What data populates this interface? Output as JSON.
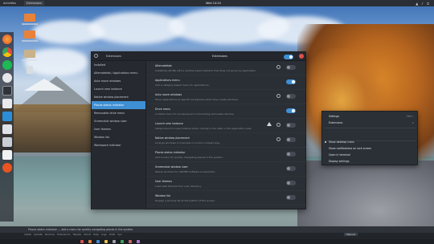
{
  "top_panel": {
    "activities": "Activities",
    "app_name": "Extensions",
    "clock": "Wed 14:24"
  },
  "settings_window": {
    "title": "Extensions",
    "master_toggle_on": true,
    "sidebar": [
      {
        "label": "Installed"
      },
      {
        "label": "Alternatetab / Applications menu"
      },
      {
        "label": "Auto move windows"
      },
      {
        "label": "Launch new instance"
      },
      {
        "label": "Native window placement"
      },
      {
        "label": "Places status indicator",
        "active": true
      },
      {
        "label": "Removable drive menu"
      },
      {
        "label": "Screenshot window sizer"
      },
      {
        "label": "User themes"
      },
      {
        "label": "Window list"
      },
      {
        "label": "Workspace indicator"
      }
    ],
    "rows": [
      {
        "title": "Alternatetab",
        "desc": "Substitute Alt-Tab with a window based switcher that does not group by application.",
        "gear": true,
        "toggle": false
      },
      {
        "title": "Applications menu",
        "desc": "Add a category-based menu for applications.",
        "gear": false,
        "toggle": true
      },
      {
        "title": "Auto move windows",
        "desc": "Move applications to specific workspaces when they create windows.",
        "gear": true,
        "toggle": false
      },
      {
        "title": "Drive menu",
        "desc": "A status menu for accessing and unmounting removable devices.",
        "gear": false,
        "toggle": true
      },
      {
        "title": "Launch new instance",
        "desc": "Always launch a new instance when clicking in the dash or the application view.",
        "gear": true,
        "warn": true,
        "toggle": false
      },
      {
        "title": "Native window placement",
        "desc": "Arrange windows in overview in a more compact way.",
        "gear": true,
        "toggle": false
      },
      {
        "title": "Places status indicator",
        "desc": "Add a menu for quickly navigating places in the system.",
        "gear": false,
        "toggle": false
      },
      {
        "title": "Screenshot window sizer",
        "desc": "Resize windows for GNOME Software screenshots.",
        "gear": false,
        "toggle": false
      },
      {
        "title": "User themes",
        "desc": "Load shell themes from user directory.",
        "gear": false,
        "toggle": false
      },
      {
        "title": "Window list",
        "desc": "Display a window list at the bottom of the screen.",
        "gear": false,
        "toggle": false
      }
    ]
  },
  "context_menu": {
    "items": [
      {
        "label": "Settings",
        "right": "Ctrl+,"
      },
      {
        "label": "Extensions",
        "right": "▸"
      },
      {
        "label": "",
        "right": ""
      },
      {
        "label": "",
        "right": ""
      },
      {
        "label": "Show desktop icons",
        "dot": true,
        "right": ""
      },
      {
        "label": "Show notifications on lock screen",
        "right": ""
      },
      {
        "label": "Open in terminal",
        "right": ""
      },
      {
        "label": "Display settings",
        "right": ""
      }
    ]
  },
  "bottom_bar": {
    "status": "Places status indicator — Add a menu for quickly navigating places in the system.",
    "tabs": [
      "Install",
      "Update",
      "Remove",
      "Extensions",
      "Tweaks",
      "About",
      "Help",
      "Logs",
      "Prefs",
      "Sys"
    ],
    "right_button": "Manual"
  },
  "colors": {
    "accent": "#3f8fd4",
    "window_bg": "#2a2e35",
    "close": "#e0504a"
  }
}
